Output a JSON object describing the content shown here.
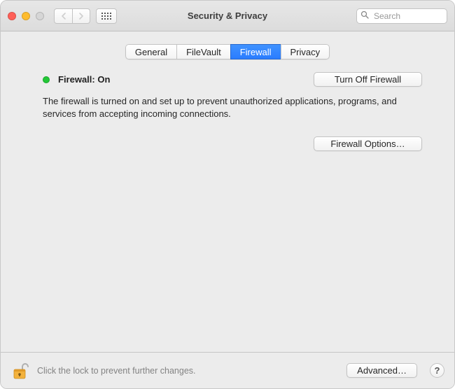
{
  "window": {
    "title": "Security & Privacy"
  },
  "search": {
    "placeholder": "Search",
    "value": ""
  },
  "tabs": [
    {
      "label": "General",
      "selected": false
    },
    {
      "label": "FileVault",
      "selected": false
    },
    {
      "label": "Firewall",
      "selected": true
    },
    {
      "label": "Privacy",
      "selected": false
    }
  ],
  "firewall": {
    "status_label": "Firewall: On",
    "status_color": "#23c737",
    "turn_off_label": "Turn Off Firewall",
    "description": "The firewall is turned on and set up to prevent unauthorized applications, programs, and services from accepting incoming connections.",
    "options_label": "Firewall Options…"
  },
  "footer": {
    "lock_text": "Click the lock to prevent further changes.",
    "advanced_label": "Advanced…",
    "help_label": "?"
  }
}
